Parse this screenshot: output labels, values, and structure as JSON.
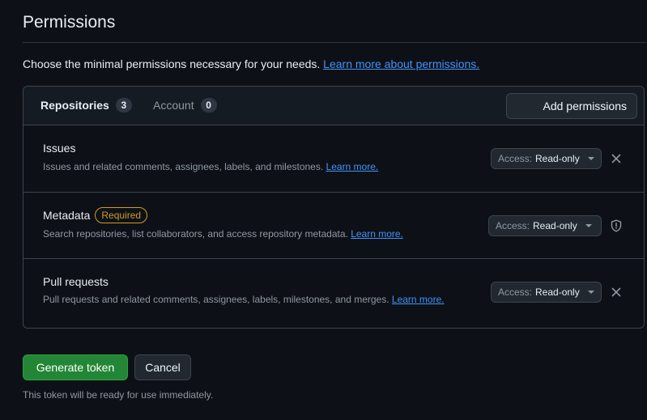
{
  "section": {
    "title": "Permissions",
    "intro_text": "Choose the minimal permissions necessary for your needs.",
    "intro_link": "Learn more about permissions."
  },
  "tabs": [
    {
      "label": "Repositories",
      "count": "3"
    },
    {
      "label": "Account",
      "count": "0"
    }
  ],
  "add_permissions_label": "Add permissions",
  "permissions": [
    {
      "name": "Issues",
      "description": "Issues and related comments, assignees, labels, and milestones.",
      "learn_more": "Learn more.",
      "access_prefix": "Access:",
      "access_value": "Read-only",
      "icon": "close-icon"
    },
    {
      "name": "Metadata",
      "badge": "Required",
      "description": "Search repositories, list collaborators, and access repository metadata.",
      "learn_more": "Learn more.",
      "access_prefix": "Access:",
      "access_value": "Read-only",
      "icon": "shield-icon"
    },
    {
      "name": "Pull requests",
      "description": "Pull requests and related comments, assignees, labels, milestones, and merges.",
      "learn_more": "Learn more.",
      "access_prefix": "Access:",
      "access_value": "Read-only",
      "icon": "close-icon"
    }
  ],
  "actions": {
    "generate_label": "Generate token",
    "cancel_label": "Cancel",
    "note": "This token will be ready for use immediately."
  },
  "colors": {
    "background": "#0d1117",
    "link": "#4493f8",
    "primary_button": "#238636",
    "required_badge": "#d29922"
  }
}
